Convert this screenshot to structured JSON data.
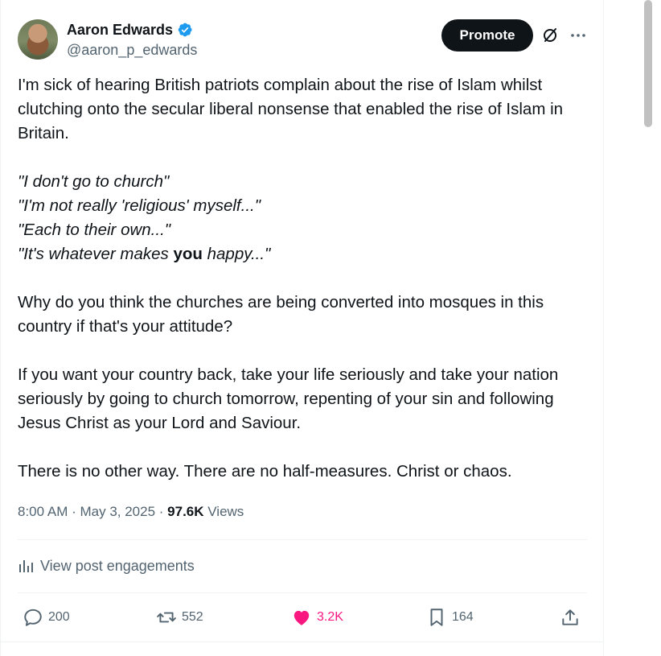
{
  "author": {
    "display_name": "Aaron Edwards",
    "handle": "@aaron_p_edwards",
    "verified": true
  },
  "header": {
    "promote_label": "Promote",
    "icons": [
      "grok-icon",
      "more-icon"
    ]
  },
  "post": {
    "paragraph_1": "I'm sick of hearing British patriots complain about the rise of Islam whilst clutching onto the secular liberal nonsense that enabled the rise of Islam in Britain.",
    "quote_1": "\"I don't go to church\"",
    "quote_2": "\"I'm not really 'religious' myself...\"",
    "quote_3": "\"Each to their own...\"",
    "quote_4_before": "\"It's whatever makes ",
    "quote_4_bold": "you",
    "quote_4_after": " happy...\"",
    "paragraph_2": "Why do you think the churches are being converted into mosques in this country if that's your attitude?",
    "paragraph_3": "If you want your country back, take your life seriously and take your nation seriously by going to church tomorrow, repenting of your sin and following Jesus Christ as your Lord and Saviour.",
    "paragraph_4": "There is no other way. There are no half-measures. Christ or chaos."
  },
  "meta": {
    "time": "8:00 AM",
    "separator": " · ",
    "date": "May 3, 2025",
    "views_count": "97.6K",
    "views_label": " Views"
  },
  "engagements": {
    "label": "View post engagements"
  },
  "actions": {
    "replies": "200",
    "reposts": "552",
    "likes": "3.2K",
    "bookmarks": "164"
  },
  "colors": {
    "like": "#f91880",
    "verified": "#1d9bf0",
    "muted": "#536471",
    "primary": "#0f1419"
  }
}
